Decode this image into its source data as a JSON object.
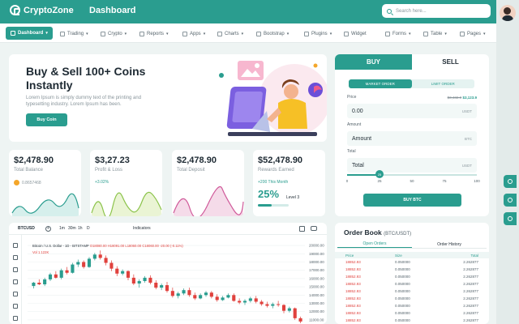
{
  "app": {
    "name": "CryptoZone",
    "page_title": "Dashboard"
  },
  "search": {
    "placeholder": "Search here..."
  },
  "menu": [
    {
      "label": "Dashboard",
      "icon": "dashboard-icon",
      "active": true
    },
    {
      "label": "Trading",
      "icon": "trading-icon"
    },
    {
      "label": "Crypto",
      "icon": "crypto-icon"
    },
    {
      "label": "Reports",
      "icon": "reports-icon"
    },
    {
      "label": "Apps",
      "icon": "apps-icon"
    },
    {
      "label": "Charts",
      "icon": "charts-icon"
    },
    {
      "label": "Bootstrap",
      "icon": "bootstrap-icon"
    },
    {
      "label": "Plugins",
      "icon": "plugins-icon"
    },
    {
      "label": "Widget",
      "icon": "widget-icon"
    },
    {
      "label": "Forms",
      "icon": "forms-icon"
    },
    {
      "label": "Table",
      "icon": "table-icon"
    },
    {
      "label": "Pages",
      "icon": "pages-icon"
    }
  ],
  "hero": {
    "title": "Buy & Sell 100+ Coins Instantly",
    "text": "Lorem Ipsum is simply dummy text of the printing and typesetting industry. Lorem Ipsum has been.",
    "button": "Buy Coin"
  },
  "stats": [
    {
      "value": "$2,478.90",
      "label": "Total Balance",
      "sub": "0.8657468"
    },
    {
      "value": "$3,27.23",
      "label": "Profit & Loss",
      "sub": "+3.02%"
    },
    {
      "value": "$2,478.90",
      "label": "Total Deposit"
    },
    {
      "value": "$52,478.90",
      "label": "Rewards Earned",
      "sub": "+200 This Month",
      "percent_text": "25%",
      "level": "Level 3",
      "progress": 0.45
    }
  ],
  "trade": {
    "tabs": [
      "BUY",
      "SELL"
    ],
    "order_types": [
      "MARKET ORDER",
      "LIMIT ORDER"
    ],
    "price_label": "Price",
    "price_note_prefix": "$3,432.0",
    "price_note_value": "$3,123.9",
    "price_value": "0.00",
    "price_unit": "USDT",
    "amount_label": "Amount",
    "amount_value": "Amount",
    "amount_unit": "BTC",
    "total_label": "Total",
    "total_value": "Total",
    "total_unit": "USDT",
    "slider_value": 25,
    "slider_ticks": [
      "0",
      "25",
      "50",
      "75",
      "100"
    ],
    "button": "BUY BTC"
  },
  "chart": {
    "symbol": "BTCUSD",
    "timeframes": [
      "1m",
      "30m",
      "1h",
      "D"
    ],
    "indicators": "Indicators",
    "legend_title": "Bitcoin / U.S. Dollar - 1D - BITSTAMP",
    "legend_ohlc": "O18080.00 H18091.00 L18060.00 C18060.00 -20.00 (-0.11%)",
    "volume": "Vol 1.122K"
  },
  "chart_data": {
    "type": "candlestick",
    "y_ticks": [
      "20000.00",
      "19000.00",
      "18000.00",
      "17000.00",
      "16000.00",
      "15000.00",
      "14000.00",
      "13000.00",
      "12000.00",
      "11000.00"
    ],
    "ylim": [
      10500,
      20500
    ],
    "colors": {
      "up": "#2a9d8f",
      "down": "#e0413d"
    },
    "candles": [
      [
        15100,
        15600,
        14800,
        15500
      ],
      [
        15500,
        15900,
        15200,
        15300
      ],
      [
        15300,
        16100,
        15100,
        15900
      ],
      [
        15900,
        16700,
        15700,
        16500
      ],
      [
        16500,
        16900,
        16000,
        16100
      ],
      [
        16100,
        17200,
        15900,
        17000
      ],
      [
        17000,
        17400,
        16500,
        16700
      ],
      [
        16700,
        17900,
        16600,
        17700
      ],
      [
        17700,
        18300,
        17400,
        18000
      ],
      [
        18000,
        18200,
        17200,
        17400
      ],
      [
        17400,
        18600,
        17300,
        18400
      ],
      [
        18400,
        19100,
        18200,
        18900
      ],
      [
        18900,
        19400,
        18300,
        18500
      ],
      [
        18500,
        18800,
        17600,
        17900
      ],
      [
        17900,
        18200,
        16900,
        17200
      ],
      [
        17200,
        17500,
        16300,
        16600
      ],
      [
        16600,
        17100,
        16400,
        16900
      ],
      [
        16900,
        17000,
        15800,
        16100
      ],
      [
        16100,
        16500,
        15200,
        15400
      ],
      [
        15400,
        15900,
        14900,
        15700
      ],
      [
        15700,
        16300,
        15500,
        16100
      ],
      [
        16100,
        16400,
        15300,
        15500
      ],
      [
        15500,
        15800,
        14700,
        14900
      ],
      [
        14900,
        15400,
        14600,
        15200
      ],
      [
        15200,
        15600,
        14300,
        14500
      ],
      [
        14500,
        14900,
        13700,
        13900
      ],
      [
        13900,
        14400,
        13600,
        14200
      ],
      [
        14200,
        14800,
        14000,
        14600
      ],
      [
        14600,
        14900,
        13800,
        14000
      ],
      [
        14000,
        14300,
        13400,
        13600
      ],
      [
        13600,
        14200,
        13500,
        14000
      ],
      [
        14000,
        14500,
        13800,
        14300
      ],
      [
        14300,
        14500,
        13600,
        13800
      ],
      [
        13800,
        14100,
        13200,
        13400
      ],
      [
        13400,
        13900,
        13300,
        13700
      ],
      [
        13700,
        14200,
        13600,
        14000
      ],
      [
        14000,
        14200,
        13200,
        13300
      ],
      [
        13300,
        13600,
        12900,
        13100
      ],
      [
        13100,
        13500,
        12800,
        13300
      ],
      [
        13300,
        13800,
        13100,
        13600
      ],
      [
        13600,
        13900,
        13000,
        13200
      ],
      [
        13200,
        13400,
        12700,
        12900
      ],
      [
        12900,
        13200,
        12500,
        12700
      ],
      [
        12700,
        13100,
        12400,
        12900
      ],
      [
        12900,
        13300,
        12600,
        12800
      ],
      [
        12800,
        12900,
        11800,
        12100
      ],
      [
        12100,
        12600,
        11900,
        12400
      ],
      [
        12400,
        12500,
        11000,
        11200
      ],
      [
        11200,
        11400,
        10600,
        10800
      ]
    ]
  },
  "order_book": {
    "title": "Order Book",
    "subtitle": "(BTC/USDT)",
    "tabs": [
      "Open Orders",
      "Order History"
    ],
    "headers": [
      "Price",
      "Size",
      "Total"
    ],
    "rows": [
      [
        "18852.93",
        "0.050000",
        "2.262877"
      ],
      [
        "18852.93",
        "0.050000",
        "2.262877"
      ],
      [
        "18852.93",
        "0.050000",
        "2.262877"
      ],
      [
        "18852.93",
        "0.050000",
        "2.262877"
      ],
      [
        "18852.93",
        "0.050000",
        "2.262877"
      ],
      [
        "18852.93",
        "0.050000",
        "2.262877"
      ],
      [
        "18852.93",
        "0.050000",
        "2.262877"
      ],
      [
        "18852.93",
        "0.050000",
        "2.262877"
      ],
      [
        "18852.93",
        "0.050000",
        "2.262877"
      ],
      [
        "18852.93",
        "0.050000",
        "2.262877"
      ]
    ]
  },
  "colors": {
    "primary": "#2a9d8f",
    "negative": "#e0413d",
    "accent_yellow": "#f4a62a"
  }
}
